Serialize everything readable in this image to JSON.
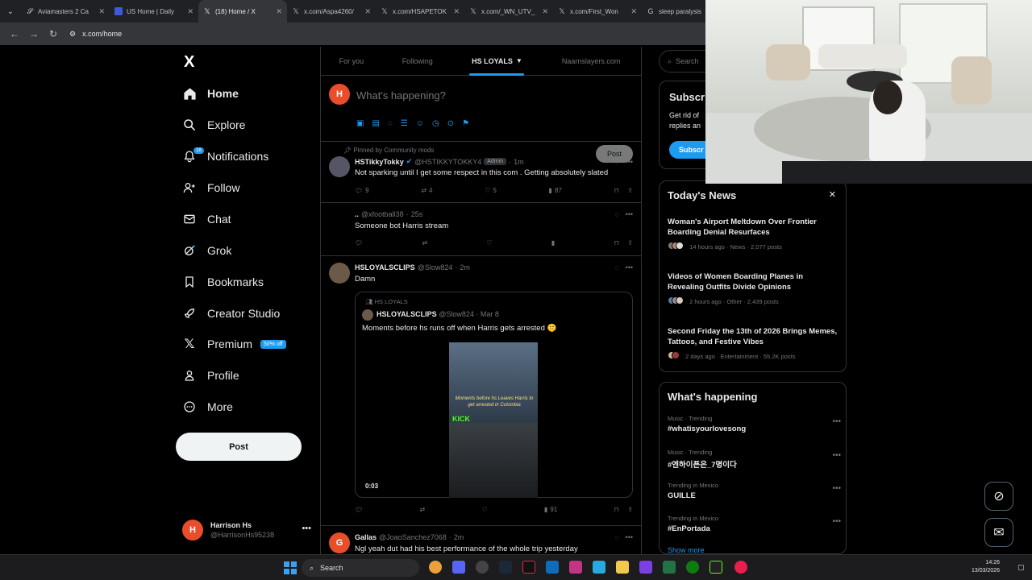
{
  "browser": {
    "tabs": [
      {
        "title": "Aviamasters 2 Ca",
        "favicon": "S"
      },
      {
        "title": "US Home | Daily",
        "favicon": "flag"
      },
      {
        "title": "(18) Home / X",
        "favicon": "X",
        "active": true
      },
      {
        "title": "x.com/Aspa4260/",
        "favicon": "X"
      },
      {
        "title": "x.com/HSAPETOK",
        "favicon": "X"
      },
      {
        "title": "x.com/_WN_UTV_",
        "favicon": "X"
      },
      {
        "title": "x.com/First_Won",
        "favicon": "X"
      },
      {
        "title": "sleep paralysis",
        "favicon": "G"
      }
    ],
    "url": "x.com/home"
  },
  "sidebar": {
    "logo": "X",
    "items": [
      {
        "label": "Home",
        "icon": "home-icon"
      },
      {
        "label": "Explore",
        "icon": "search-icon"
      },
      {
        "label": "Notifications",
        "icon": "bell-icon",
        "badge": "18"
      },
      {
        "label": "Follow",
        "icon": "person-add-icon"
      },
      {
        "label": "Chat",
        "icon": "mail-icon"
      },
      {
        "label": "Grok",
        "icon": "grok-icon"
      },
      {
        "label": "Bookmarks",
        "icon": "bookmark-icon"
      },
      {
        "label": "Creator Studio",
        "icon": "rocket-icon"
      },
      {
        "label": "Premium",
        "icon": "x-icon",
        "badge": "50% off"
      },
      {
        "label": "Profile",
        "icon": "person-icon"
      },
      {
        "label": "More",
        "icon": "more-circle-icon"
      }
    ],
    "post_label": "Post",
    "account": {
      "name": "Harrison Hs",
      "handle": "@HarrisonHs95238",
      "initial": "H"
    }
  },
  "feed": {
    "tabs": [
      "For you",
      "Following",
      "HS LOYALS",
      "Naarnslayers.com"
    ],
    "composer": {
      "placeholder": "What's happening?",
      "post_label": "Post",
      "initial": "H"
    },
    "tweets": [
      {
        "pinned_label": "Pinned by Community mods",
        "name": "HSTikkyTokky",
        "handle": "@HSTIKKYTOKKY4",
        "role": "Admin",
        "time": "1m",
        "text": "Not sparking until I get some respect in this com . Getting absolutely slated",
        "replies": "9",
        "reposts": "4",
        "likes": "5",
        "views": "87"
      },
      {
        "handle": "@xfootball38",
        "time": "25s",
        "text": "Someone bot Harris stream"
      },
      {
        "name": "HSLOYALSCLIPS",
        "handle": "@Slow824",
        "time": "2m",
        "text": "Damn",
        "views": "91",
        "quote": {
          "community": "HS LOYALS",
          "name": "HSLOYALSCLIPS",
          "handle": "@Slow824",
          "time": "Mar 8",
          "text": "Moments before hs runs off when Harris gets arrested 🤫",
          "media_caption": "Moments before hs Leaves Harris to get arrested in Colombia",
          "media_brand": "KICK",
          "duration": "0:03"
        }
      },
      {
        "name": "Gallas",
        "handle": "@JoaoSanchez7068",
        "time": "2m",
        "text": "Ngl yeah dut had his best performance of the whole trip yesterday",
        "initial": "G"
      }
    ]
  },
  "right": {
    "search_placeholder": "Search",
    "subscribe": {
      "title": "Subscr",
      "text": "Get rid of",
      "text2": "replies an",
      "button": "Subscr"
    },
    "news": {
      "title": "Today's News",
      "items": [
        {
          "title": "Woman's Airport Meltdown Over Frontier Boarding Denial Resurfaces",
          "meta": "14 hours ago · News · 2,077 posts"
        },
        {
          "title": "Videos of Women Boarding Planes in Revealing Outfits Divide Opinions",
          "meta": "2 hours ago · Other · 2,439 posts"
        },
        {
          "title": "Second Friday the 13th of 2026 Brings Memes, Tattoos, and Festive Vibes",
          "meta": "2 days ago · Entertainment · 55.2K posts"
        }
      ]
    },
    "happening": {
      "title": "What's happening",
      "items": [
        {
          "category": "Music · Trending",
          "tag": "#whatisyourlovesong"
        },
        {
          "category": "Music · Trending",
          "tag": "#엔하이픈은_7명이다"
        },
        {
          "category": "Trending in Mexico",
          "tag": "GUILLE"
        },
        {
          "category": "Trending in Mexico",
          "tag": "#EnPortada"
        }
      ],
      "show_more": "Show more"
    }
  },
  "taskbar": {
    "search": "Search",
    "time": "14:26",
    "date": "13/03/2026"
  }
}
